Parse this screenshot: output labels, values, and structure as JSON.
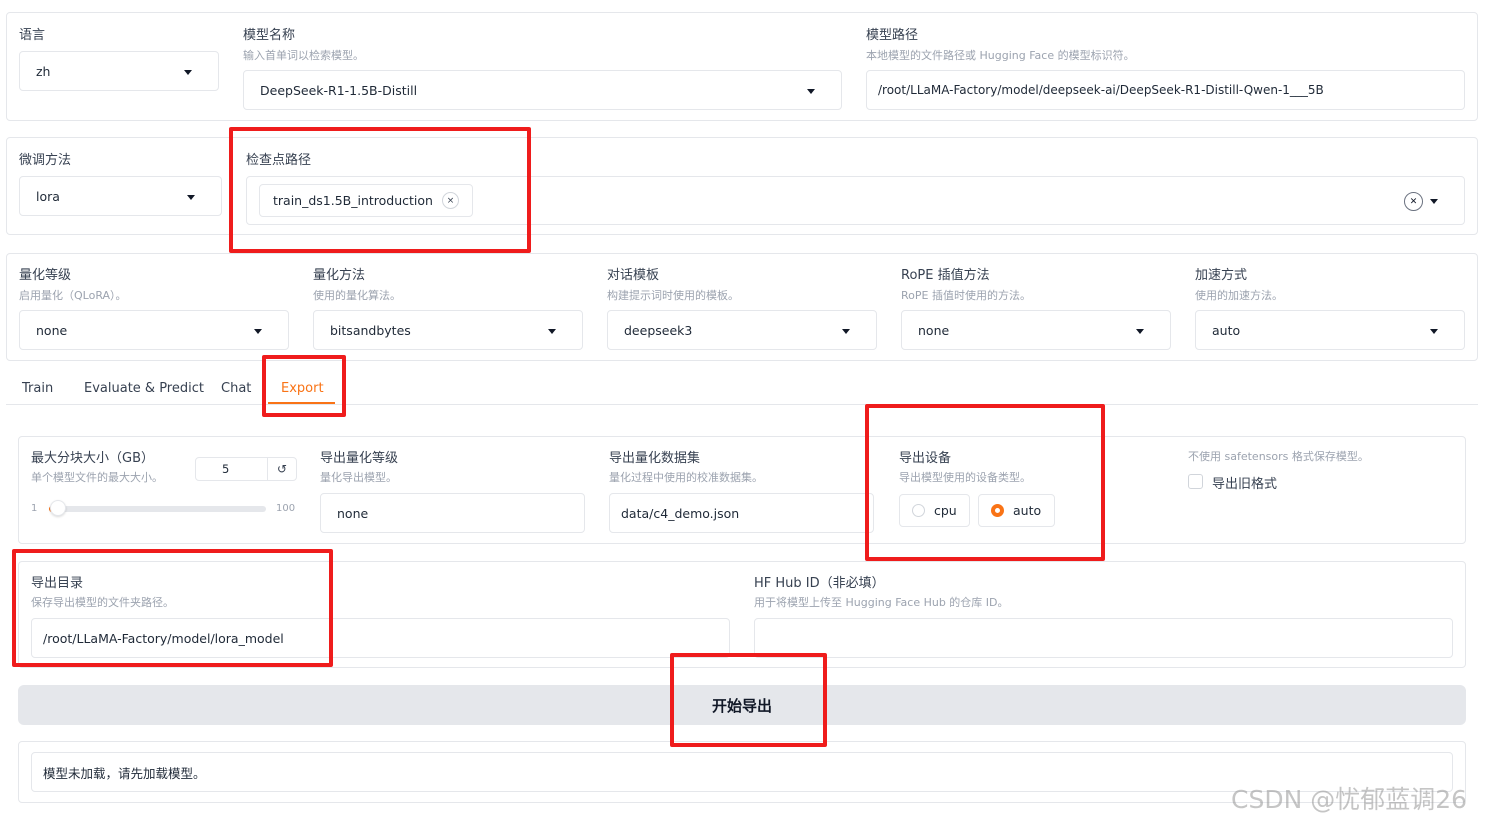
{
  "row1": {
    "language": {
      "label": "语言",
      "value": "zh"
    },
    "model_name": {
      "label": "模型名称",
      "info": "输入首单词以检索模型。",
      "value": "DeepSeek-R1-1.5B-Distill"
    },
    "model_path": {
      "label": "模型路径",
      "info": "本地模型的文件路径或 Hugging Face 的模型标识符。",
      "value": "/root/LLaMA-Factory/model/deepseek-ai/DeepSeek-R1-Distill-Qwen-1___5B"
    }
  },
  "row2": {
    "finetune": {
      "label": "微调方法",
      "value": "lora"
    },
    "checkpoint": {
      "label": "检查点路径",
      "chip": "train_ds1.5B_introduction",
      "chip_remove": "×",
      "clear": "✕"
    }
  },
  "row3": {
    "quant_bit": {
      "label": "量化等级",
      "info": "启用量化（QLoRA）。",
      "value": "none"
    },
    "quant_method": {
      "label": "量化方法",
      "info": "使用的量化算法。",
      "value": "bitsandbytes"
    },
    "template": {
      "label": "对话模板",
      "info": "构建提示词时使用的模板。",
      "value": "deepseek3"
    },
    "rope": {
      "label": "RoPE 插值方法",
      "info": "RoPE 插值时使用的方法。",
      "value": "none"
    },
    "booster": {
      "label": "加速方式",
      "info": "使用的加速方法。",
      "value": "auto"
    }
  },
  "tabs": [
    "Train",
    "Evaluate & Predict",
    "Chat",
    "Export"
  ],
  "active_tab": "Export",
  "export": {
    "max_shard": {
      "label": "最大分块大小（GB）",
      "info": "单个模型文件的最大大小。",
      "value": "5",
      "reset": "↺",
      "min": "1",
      "max": "100",
      "fraction": 0.04
    },
    "quant_bit": {
      "label": "导出量化等级",
      "info": "量化导出模型。",
      "value": "none"
    },
    "quant_dataset": {
      "label": "导出量化数据集",
      "info": "量化过程中使用的校准数据集。",
      "value": "data/c4_demo.json"
    },
    "device": {
      "label": "导出设备",
      "info": "导出模型使用的设备类型。",
      "options": [
        "cpu",
        "auto"
      ],
      "selected": "auto"
    },
    "legacy": {
      "info": "不使用 safetensors 格式保存模型。",
      "label": "导出旧格式",
      "checked": false
    },
    "dir": {
      "label": "导出目录",
      "info": "保存导出模型的文件夹路径。",
      "value": "/root/LLaMA-Factory/model/lora_model"
    },
    "hub_id": {
      "label": "HF Hub ID（非必填）",
      "info": "用于将模型上传至 Hugging Face Hub 的仓库 ID。",
      "value": ""
    },
    "start_button": "开始导出",
    "output": "模型未加载，请先加载模型。"
  },
  "watermark": "CSDN @忧郁蓝调26",
  "colors": {
    "accent": "#f97316",
    "highlight": "#ef1c1c"
  }
}
